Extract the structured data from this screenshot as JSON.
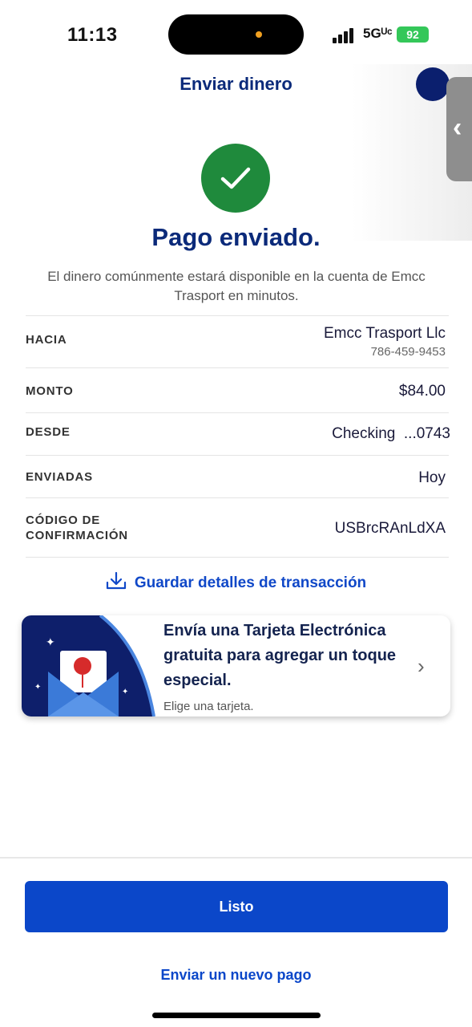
{
  "status_bar": {
    "time": "11:13",
    "network": "5Gᵁᶜ",
    "battery": "92"
  },
  "header": {
    "title": "Enviar dinero"
  },
  "success": {
    "title": "Pago enviado.",
    "message": "El dinero comúnmente estará disponible en la cuenta de Emcc Trasport en minutos."
  },
  "details": [
    {
      "label": "HACIA",
      "value": "Emcc Trasport Llc",
      "sub": "786-459-9453"
    },
    {
      "label": "MONTO",
      "value": "$84.00"
    },
    {
      "label": "DESDE",
      "value": "Checking  ...0743"
    },
    {
      "label": "ENVIADAS",
      "value": "Hoy"
    },
    {
      "label": "CÓDIGO DE CONFIRMACIÓN",
      "label_line1": "CÓDIGO DE",
      "label_line2": "CONFIRMACIÓN",
      "value": "USBrcRAnLdXA"
    }
  ],
  "save_link": "Guardar detalles de transacción",
  "promo": {
    "title": "Envía una Tarjeta Electrónica gratuita para agregar un toque especial.",
    "subtitle": "Elige una tarjeta."
  },
  "buttons": {
    "done": "Listo",
    "new_payment": "Enviar un nuevo pago"
  },
  "colors": {
    "brand_blue": "#0b47c9",
    "navy": "#0b2a7a",
    "success_green": "#1f8a3c"
  },
  "icons": [
    "check-icon",
    "download-icon",
    "envelope-card-icon",
    "chevron-right-icon",
    "chevron-left-icon"
  ]
}
